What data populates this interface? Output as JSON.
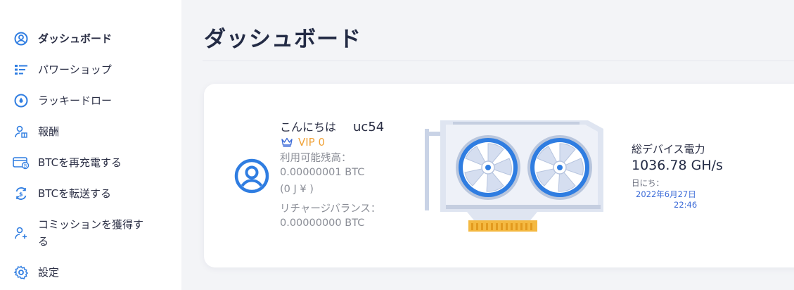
{
  "sidebar": {
    "items": [
      {
        "label": "ダッシュボード",
        "icon": "user-circle-icon",
        "active": true
      },
      {
        "label": "パワーショップ",
        "icon": "list-icon"
      },
      {
        "label": "ラッキードロー",
        "icon": "drop-circle-icon"
      },
      {
        "label": "報酬",
        "icon": "user-gift-icon"
      },
      {
        "label": "BTCを再充電する",
        "icon": "card-bitcoin-icon"
      },
      {
        "label": "BTCを転送する",
        "icon": "transfer-dollar-icon"
      },
      {
        "label": "コミッションを獲得する",
        "icon": "user-plus-icon"
      },
      {
        "label": "設定",
        "icon": "gear-icon"
      }
    ]
  },
  "header": {
    "title": "ダッシュボード"
  },
  "card": {
    "greeting": "こんにちは",
    "username": "uc54",
    "vip": "VIP 0",
    "balance_label": "利用可能残高：",
    "balance_value": "0.00000001 BTC",
    "balance_fiat": "(0 J ¥ )",
    "recharge_label": "リチャージバランス：",
    "recharge_value": "0.00000000 BTC",
    "total_power_label": "総デバイス電力",
    "total_power_value": "1036.78 GH/s",
    "date_label": "日にち：",
    "date_value": "2022年6月27日",
    "time_value": "22:46"
  },
  "colors": {
    "accent_blue": "#2f7de1",
    "vip_orange": "#f0a33a",
    "date_blue": "#3d6cd8",
    "sidebar_bg": "#ffffff",
    "main_bg": "#f3f4f7"
  }
}
